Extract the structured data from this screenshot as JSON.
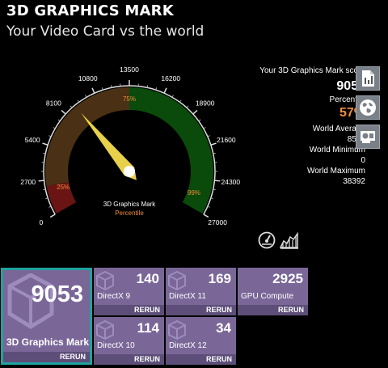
{
  "header": {
    "title": "3D GRAPHICS MARK",
    "subtitle": "Your Video Card vs the world"
  },
  "gauge": {
    "min": 0,
    "max": 27000,
    "value": 9053,
    "ticks": [
      "0",
      "2700",
      "5400",
      "8100",
      "10800",
      "13500",
      "16200",
      "18900",
      "21600",
      "24300",
      "27000"
    ],
    "percent_marks": [
      "25%",
      "75%",
      "99%"
    ],
    "center_label": "3D Graphics Mark",
    "center_sublabel": "Percentile",
    "colors": {
      "low": "#6b1414",
      "mid": "#4a3014",
      "high": "#0a4a0a",
      "needle": "#e8d14a",
      "pct_text": "#f08c3c"
    }
  },
  "stats": {
    "score_label": "Your 3D Graphics Mark score",
    "score": "9053",
    "percentile_label": "Percentile",
    "percentile": "57%",
    "world_avg_label": "World Average",
    "world_avg": "8506",
    "world_min_label": "World Minimum",
    "world_min": "0",
    "world_max_label": "World Maximum",
    "world_max": "38392"
  },
  "side_icons": [
    "report-icon",
    "globe-icon",
    "graphics-card-icon"
  ],
  "mini_icons": [
    "gauge-icon",
    "chart-icon"
  ],
  "tiles": {
    "main": {
      "value": "9053",
      "name": "3D Graphics Mark",
      "rerun": "RERUN"
    },
    "dx9": {
      "value": "140",
      "name": "DirectX 9",
      "rerun": "RERUN"
    },
    "dx11": {
      "value": "169",
      "name": "DirectX 11",
      "rerun": "RERUN"
    },
    "gpu": {
      "value": "2925",
      "name": "GPU Compute",
      "rerun": "RERUN"
    },
    "dx10": {
      "value": "114",
      "name": "DirectX 10",
      "rerun": "RERUN"
    },
    "dx12": {
      "value": "34",
      "name": "DirectX 12",
      "rerun": "RERUN"
    }
  }
}
